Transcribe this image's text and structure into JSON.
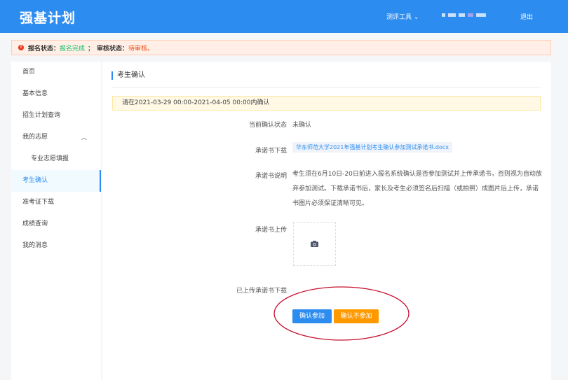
{
  "header": {
    "logo": "强基计划",
    "tools_label": "测评工具",
    "logout_label": "退出"
  },
  "alert": {
    "reg_label": "报名状态：",
    "reg_value": "报名完成",
    "sep": "；",
    "review_label": "审核状态：",
    "review_value": "待审核。"
  },
  "sidebar": {
    "items": [
      {
        "label": "首页"
      },
      {
        "label": "基本信息"
      },
      {
        "label": "招生计划查询"
      },
      {
        "label": "我的志愿"
      },
      {
        "label": "专业志愿填报"
      },
      {
        "label": "考生确认"
      },
      {
        "label": "准考证下载"
      },
      {
        "label": "成绩查询"
      },
      {
        "label": "我的消息"
      }
    ]
  },
  "main": {
    "title": "考生确认",
    "notice": "请在2021-03-29 00:00-2021-04-05 00:00内确认",
    "status_label": "当前确认状态",
    "status_value": "未确认",
    "download_label": "承诺书下载",
    "download_file": "华东师范大学2021年强基计划考生确认参加测试承诺书.docx",
    "desc_label": "承诺书说明",
    "desc_text": "考生须在6月10日-20日前进入报名系统确认是否参加测试并上传承诺书，否则视为自动放弃参加测试。下载承诺书后，家长及考生必须签名后扫描（或拍照）成图片后上传，承诺书图片必须保证清晰可见。",
    "upload_label": "承诺书上传",
    "uploaded_label": "已上传承诺书下载",
    "confirm_button": "确认参加",
    "decline_button": "确认不参加"
  },
  "colors": {
    "primary": "#2d8cf0",
    "warning": "#ff9900",
    "annotation": "#c8102e"
  }
}
